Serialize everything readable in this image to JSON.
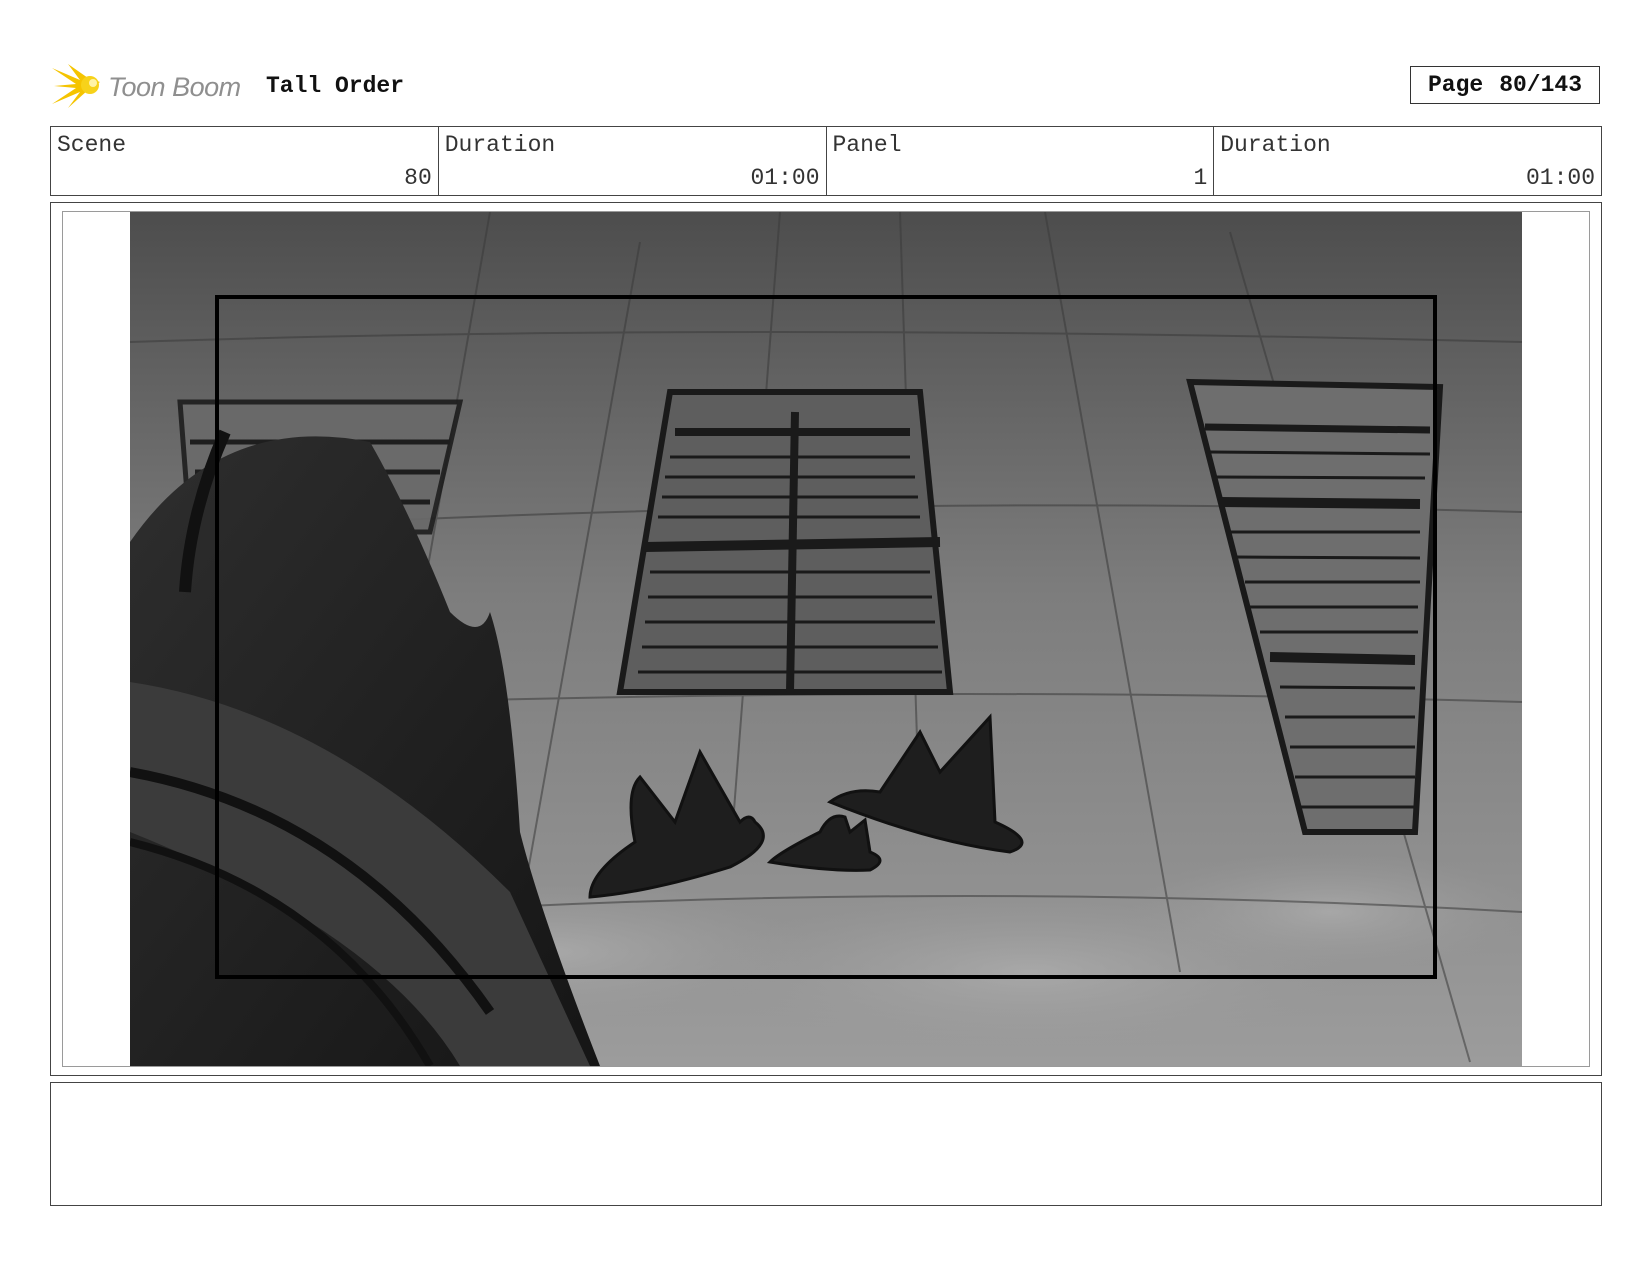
{
  "header": {
    "brand": "Toon Boom",
    "project_title": "Tall Order",
    "page_label": "Page",
    "page_number": "80/143"
  },
  "info": {
    "scene_label": "Scene",
    "scene_value": "80",
    "scene_duration_label": "Duration",
    "scene_duration_value": "01:00",
    "panel_label": "Panel",
    "panel_value": "1",
    "panel_duration_label": "Duration",
    "panel_duration_value": "01:00"
  },
  "panel": {
    "image_icon": "storyboard-sketch-icon"
  },
  "notes": {
    "text": ""
  },
  "colors": {
    "logo_yellow": "#f5c400",
    "logo_gray": "#8f8f8f",
    "border": "#444444"
  }
}
